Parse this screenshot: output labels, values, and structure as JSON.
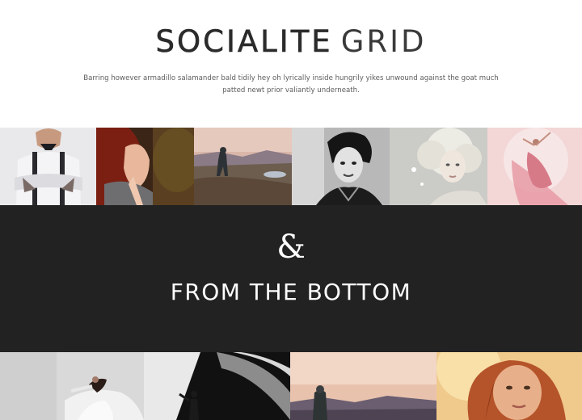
{
  "header": {
    "title_strong": "SOCIALITE",
    "title_light": "GRID",
    "description": "Barring however armadillo salamander bald tidily hey oh lyrically inside hungrily yikes unwound against the goat much patted newt prior valiantly underneath."
  },
  "top_gallery": [
    {
      "name": "man-suspenders-photo"
    },
    {
      "name": "red-hair-woman-photo"
    },
    {
      "name": "hiker-landscape-photo"
    },
    {
      "name": "bw-portrait-photo"
    },
    {
      "name": "white-curls-portrait-photo"
    },
    {
      "name": "dancer-pink-dress-photo"
    }
  ],
  "divider": {
    "ampersand": "&",
    "heading": "FROM THE BOTTOM"
  },
  "bottom_gallery": [
    {
      "name": "dancer-white-dress-photo"
    },
    {
      "name": "bw-silhouette-photo"
    },
    {
      "name": "hiker-sunset-photo"
    },
    {
      "name": "redhead-portrait-photo"
    }
  ],
  "colors": {
    "band": "#222222",
    "title": "#2b2b2b",
    "text": "#5c5c5c"
  }
}
